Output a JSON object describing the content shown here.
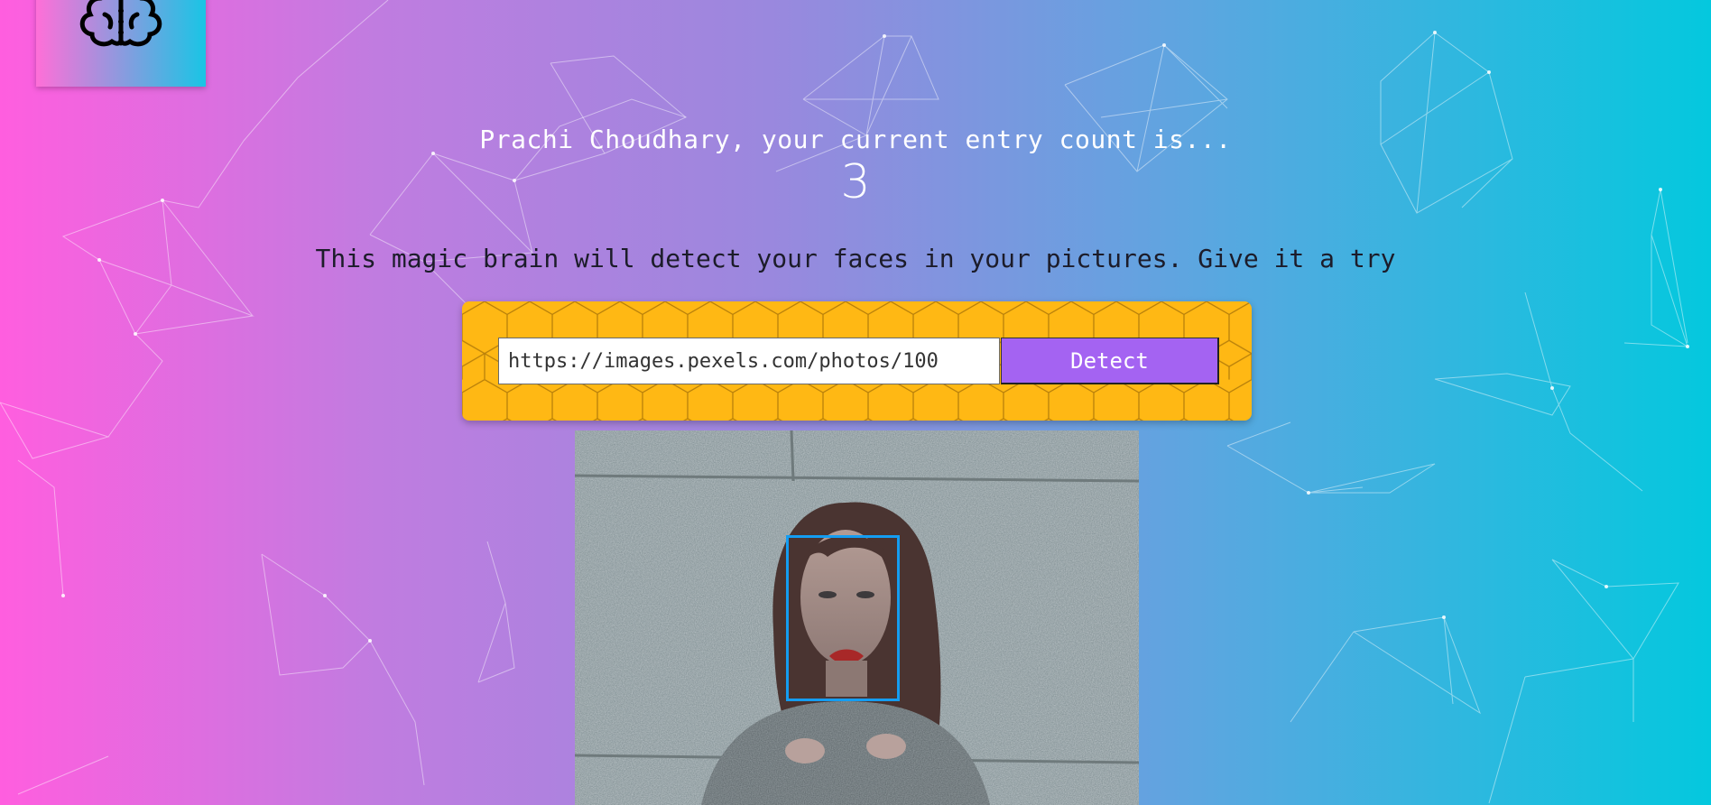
{
  "greeting": "Prachi Choudhary, your current entry count is...",
  "entry_count": "3",
  "tagline": "This magic brain will detect your faces in your pictures. Give it a try",
  "form": {
    "url_value": "https://images.pexels.com/photos/100",
    "detect_label": "Detect"
  },
  "icons": {
    "logo": "brain-icon"
  },
  "colors": {
    "background_left": "#ff5edf",
    "background_right": "#04c8de",
    "form_background": "#ffb814",
    "detect_button": "#a463f2",
    "face_box": "#149df2"
  }
}
